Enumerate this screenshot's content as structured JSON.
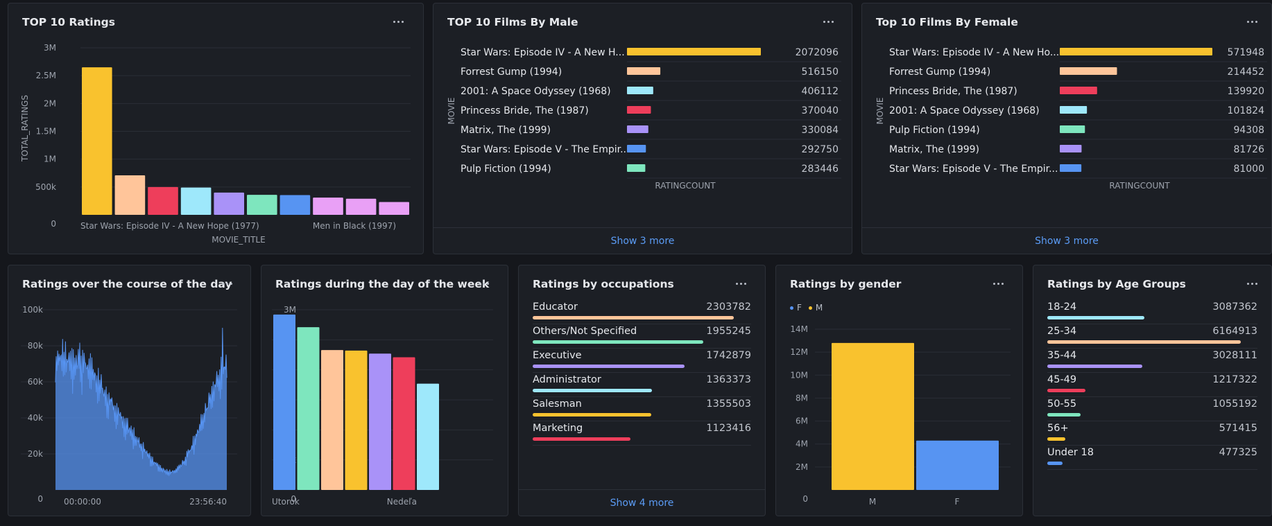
{
  "colors": {
    "yellow": "#f9c22e",
    "peach": "#ffc59a",
    "red": "#ee3e5b",
    "cyan": "#9ee8fb",
    "purple": "#a992f8",
    "mint": "#7ee6be",
    "blue": "#5794f2",
    "pink": "#e9a0f6"
  },
  "cards": {
    "top10_ratings": {
      "title": "TOP 10 Ratings"
    },
    "male": {
      "title": "TOP 10 Films By Male",
      "show_more": "Show 3 more"
    },
    "female": {
      "title": "Top 10 Films By Female",
      "show_more": "Show 3 more"
    },
    "day": {
      "title": "Ratings over the course of the day"
    },
    "week": {
      "title": "Ratings during the day of the week"
    },
    "occupations": {
      "title": "Ratings by occupations",
      "show_more": "Show 4 more"
    },
    "gender": {
      "title": "Ratings by gender"
    },
    "age": {
      "title": "Ratings by Age Groups"
    }
  },
  "chart_data": [
    {
      "id": "top10",
      "type": "bar",
      "xlabel": "MOVIE_TITLE",
      "ylabel": "TOTAL_RATINGS",
      "ylim": [
        0,
        3000000
      ],
      "yticks": [
        "0",
        "500k",
        "1M",
        "1.5M",
        "2M",
        "2.5M",
        "3M"
      ],
      "xticks": [
        "Star Wars: Episode IV - A New Hope (1977)",
        "Men in Black (1997)"
      ],
      "values": [
        2650000,
        710000,
        500000,
        490000,
        400000,
        360000,
        355000,
        310000,
        290000,
        230000
      ],
      "colors": [
        "#f9c22e",
        "#ffc59a",
        "#ee3e5b",
        "#9ee8fb",
        "#a992f8",
        "#7ee6be",
        "#5794f2",
        "#e9a0f6",
        "#e9a0f6",
        "#e9a0f6"
      ]
    },
    {
      "id": "male",
      "type": "bar",
      "orientation": "horizontal",
      "xlabel": "RATINGCOUNT",
      "ylabel": "MOVIE",
      "categories": [
        "Star Wars: Episode IV - A New H...",
        "Forrest Gump (1994)",
        "2001: A Space Odyssey (1968)",
        "Princess Bride, The (1987)",
        "Matrix, The (1999)",
        "Star Wars: Episode V - The Empir...",
        "Pulp Fiction (1994)"
      ],
      "values": [
        2072096,
        516150,
        406112,
        370040,
        330084,
        292750,
        283446
      ],
      "colors": [
        "#f9c22e",
        "#ffc59a",
        "#9ee8fb",
        "#ee3e5b",
        "#a992f8",
        "#5794f2",
        "#7ee6be"
      ]
    },
    {
      "id": "female",
      "type": "bar",
      "orientation": "horizontal",
      "xlabel": "RATINGCOUNT",
      "ylabel": "MOVIE",
      "categories": [
        "Star Wars: Episode IV - A New Ho...",
        "Forrest Gump (1994)",
        "Princess Bride, The (1987)",
        "2001: A Space Odyssey (1968)",
        "Pulp Fiction (1994)",
        "Matrix, The (1999)",
        "Star Wars: Episode V - The Empir..."
      ],
      "values": [
        571948,
        214452,
        139920,
        101824,
        94308,
        81726,
        81000
      ],
      "colors": [
        "#f9c22e",
        "#ffc59a",
        "#ee3e5b",
        "#9ee8fb",
        "#7ee6be",
        "#a992f8",
        "#5794f2"
      ]
    },
    {
      "id": "day",
      "type": "area",
      "ylim": [
        0,
        100000
      ],
      "yticks": [
        "0",
        "20k",
        "40k",
        "60k",
        "80k",
        "100k"
      ],
      "xticks": [
        "00:00:00",
        "23:56:40"
      ],
      "color": "#5794f2"
    },
    {
      "id": "week",
      "type": "bar",
      "ylim": [
        0,
        3000000
      ],
      "yticks": [
        "0",
        "500k",
        "1M",
        "1.5M",
        "2M",
        "2.5M",
        "3M"
      ],
      "xticks": [
        "Utorok",
        "Nedeľa"
      ],
      "values": [
        2920000,
        2710000,
        2330000,
        2320000,
        2270000,
        2210000,
        1770000
      ],
      "colors": [
        "#5794f2",
        "#7ee6be",
        "#ffc59a",
        "#f9c22e",
        "#a992f8",
        "#ee3e5b",
        "#9ee8fb"
      ]
    },
    {
      "id": "occupations",
      "type": "bar",
      "orientation": "horizontal",
      "categories": [
        "Educator",
        "Others/Not Specified",
        "Executive",
        "Administrator",
        "Salesman",
        "Marketing"
      ],
      "values": [
        2303782,
        1955245,
        1742879,
        1363373,
        1355503,
        1123416
      ],
      "colors": [
        "#ffc59a",
        "#7ee6be",
        "#a992f8",
        "#9ee8fb",
        "#f9c22e",
        "#ee3e5b"
      ]
    },
    {
      "id": "gender",
      "type": "bar",
      "ylim": [
        0,
        14000000
      ],
      "yticks": [
        "0",
        "2M",
        "4M",
        "6M",
        "8M",
        "10M",
        "12M",
        "14M"
      ],
      "categories": [
        "M",
        "F"
      ],
      "values": [
        12800000,
        4300000
      ],
      "colors": [
        "#f9c22e",
        "#5794f2"
      ],
      "legend": [
        {
          "name": "F",
          "color": "#5794f2"
        },
        {
          "name": "M",
          "color": "#f9c22e"
        }
      ]
    },
    {
      "id": "age",
      "type": "bar",
      "orientation": "horizontal",
      "categories": [
        "18-24",
        "25-34",
        "35-44",
        "45-49",
        "50-55",
        "56+",
        "Under 18"
      ],
      "values": [
        3087362,
        6164913,
        3028111,
        1217322,
        1055192,
        571415,
        477325
      ],
      "colors": [
        "#9ee8fb",
        "#ffc59a",
        "#a992f8",
        "#ee3e5b",
        "#7ee6be",
        "#f9c22e",
        "#5794f2"
      ]
    }
  ]
}
